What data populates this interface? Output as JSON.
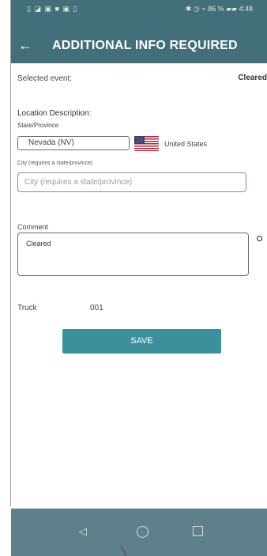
{
  "status_bar": {
    "left_text": "▯ ◪ ▣ ■ ▣ ▯",
    "right_text": "✱ ◷ ⌁ 86 % ▰▰ 4:48"
  },
  "app_bar": {
    "back_icon": "arrow-left-icon",
    "back_symbol": "←",
    "title": "ADDITIONAL INFO REQUIRED"
  },
  "event": {
    "selected_label": "Selected event:",
    "selected_value": "Cleared"
  },
  "location": {
    "section_title": "Location Description:",
    "state_label": "State/Province",
    "state_value": "Nevada (NV)",
    "flag_icon": "us-flag-icon",
    "country": "United States",
    "city_label": "City (requires a state/province)",
    "city_placeholder": "City (requires a state/province)"
  },
  "comment": {
    "label": "Comment",
    "value": "Cleared",
    "icon": "circle-icon"
  },
  "truck": {
    "label": "Truck",
    "value": "001"
  },
  "actions": {
    "save_label": "SAVE",
    "save_color": "#3b909c"
  },
  "navigation": {
    "back_icon": "triangle-back-icon",
    "home_icon": "home-circle-icon",
    "recent_icon": "recent-apps-square-icon"
  },
  "colors": {
    "app_bar": "#426f79",
    "nav_bar": "#5f7f8a",
    "accent": "#3b909c"
  }
}
